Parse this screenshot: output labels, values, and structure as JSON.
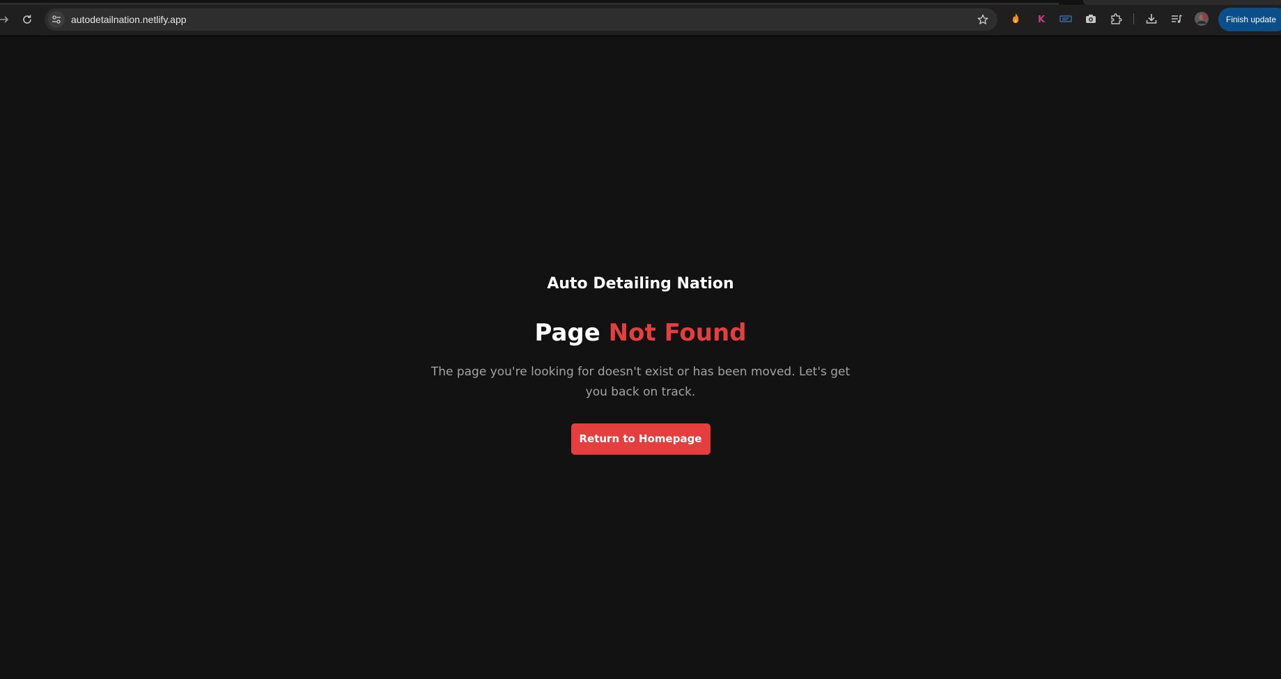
{
  "browser": {
    "url": "autodetailnation.netlify.app",
    "finish_update_label": "Finish update",
    "icons": [
      "forward-icon",
      "reload-icon",
      "site-info-icon",
      "bookmark-star-icon",
      "extension-flame-icon",
      "extension-k-icon",
      "extension-blue-icon",
      "screenshot-icon",
      "extensions-puzzle-icon",
      "download-icon",
      "media-queue-icon",
      "profile-avatar-icon"
    ]
  },
  "page": {
    "brand": "Auto Detailing Nation",
    "heading_prefix": "Page",
    "heading_accent": "Not Found",
    "description": "The page you're looking for doesn't exist or has been moved. Let's get you back on track.",
    "cta_label": "Return to Homepage"
  },
  "colors": {
    "background": "#121212",
    "accent": "#e53e3e",
    "text": "#ffffff",
    "muted_text": "#a3a3a3",
    "update_button": "#0b4f8a"
  }
}
